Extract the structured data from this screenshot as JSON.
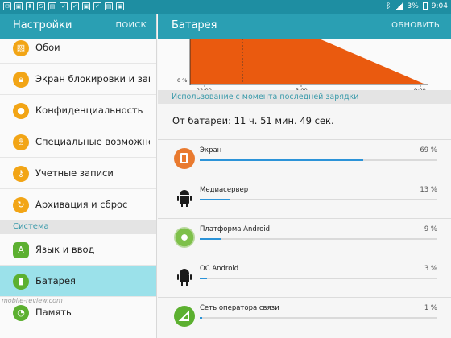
{
  "status_bar": {
    "battery": "3%",
    "time": "9:04"
  },
  "left_pane": {
    "title": "Настройки",
    "search": "ПОИСК",
    "items": [
      {
        "label": "Обои",
        "icon": "wallpaper-icon"
      },
      {
        "label": "Экран блокировки и защита",
        "icon": "lock-icon"
      },
      {
        "label": "Конфиденциальность",
        "icon": "privacy-icon"
      },
      {
        "label": "Специальные возможности",
        "icon": "hand-icon"
      },
      {
        "label": "Учетные записи",
        "icon": "key-icon"
      },
      {
        "label": "Архивация и сброс",
        "icon": "backup-icon"
      }
    ],
    "section_system": "Система",
    "system_items": [
      {
        "label": "Язык и ввод",
        "icon": "language-icon"
      },
      {
        "label": "Батарея",
        "icon": "battery-icon",
        "selected": true
      },
      {
        "label": "Память",
        "icon": "memory-icon"
      }
    ],
    "watermark": "mobile-review.com"
  },
  "right_pane": {
    "title": "Батарея",
    "update": "ОБНОВИТЬ",
    "chart_data": {
      "type": "area",
      "y_label_zero": "0 %",
      "x_ticks": [
        "22:00",
        "3:00",
        "9:00"
      ],
      "fill_color": "#ea5a0f"
    },
    "usage_header": "Использование с момента последней зарядки",
    "since_charge": "От батареи: 11 ч. 51 мин. 49 сек.",
    "apps": [
      {
        "name": "Экран",
        "percent": "69 %",
        "value": 69,
        "icon": "screen-icon"
      },
      {
        "name": "Медиасервер",
        "percent": "13 %",
        "value": 13,
        "icon": "android-icon"
      },
      {
        "name": "Платформа Android",
        "percent": "9 %",
        "value": 9,
        "icon": "android-platform-icon"
      },
      {
        "name": "ОС Android",
        "percent": "3 %",
        "value": 3,
        "icon": "android-icon"
      },
      {
        "name": "Сеть оператора связи",
        "percent": "1 %",
        "value": 1,
        "icon": "signal-icon"
      }
    ]
  }
}
